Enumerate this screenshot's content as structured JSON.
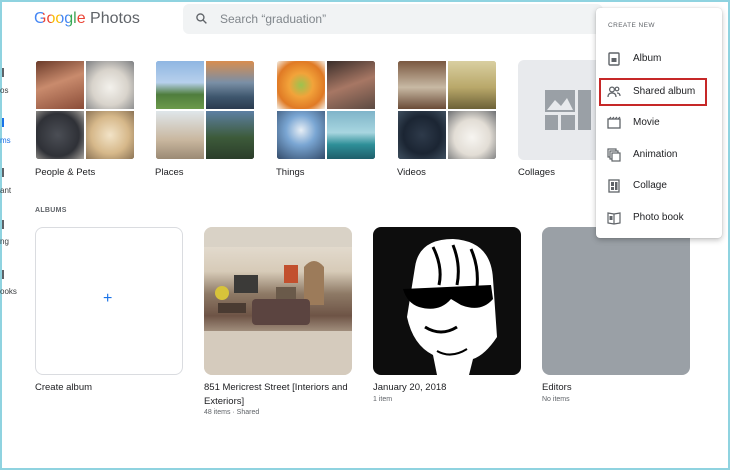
{
  "app": {
    "logo_google": "Google",
    "logo_photos": "Photos"
  },
  "search": {
    "placeholder": "Search “graduation”"
  },
  "sidebar_fragments": [
    "os",
    "ms",
    "ant",
    "ng",
    "ooks"
  ],
  "categories": [
    {
      "label": "People & Pets"
    },
    {
      "label": "Places"
    },
    {
      "label": "Things"
    },
    {
      "label": "Videos"
    },
    {
      "label": "Collages"
    }
  ],
  "albums_section": {
    "label": "ALBUMS"
  },
  "albums": [
    {
      "title": "Create album",
      "meta": ""
    },
    {
      "title": "851 Mericrest Street [Interiors and Exteriors]",
      "meta": "48 items · Shared"
    },
    {
      "title": "January 20, 2018",
      "meta": "1 item"
    },
    {
      "title": "Editors",
      "meta": "No items"
    }
  ],
  "create_album_plus": "+",
  "create_menu": {
    "header": "CREATE NEW",
    "items": [
      {
        "label": "Album",
        "icon": "album-icon"
      },
      {
        "label": "Shared album",
        "icon": "shared-album-icon",
        "highlighted": true
      },
      {
        "label": "Movie",
        "icon": "movie-icon"
      },
      {
        "label": "Animation",
        "icon": "animation-icon"
      },
      {
        "label": "Collage",
        "icon": "collage-icon"
      },
      {
        "label": "Photo book",
        "icon": "photo-book-icon"
      }
    ]
  },
  "colors": {
    "accent": "#1a73e8",
    "highlight_box": "#c62828",
    "frame": "#8fd3e0"
  }
}
